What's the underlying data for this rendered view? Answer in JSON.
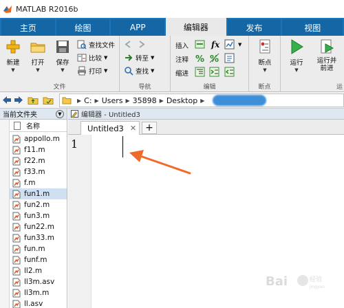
{
  "window": {
    "title": "MATLAB R2016b"
  },
  "ribbon_tabs": [
    {
      "label": "主页"
    },
    {
      "label": "绘图"
    },
    {
      "label": "APP"
    },
    {
      "label": "编辑器"
    },
    {
      "label": "发布"
    },
    {
      "label": "视图"
    }
  ],
  "ribbon": {
    "new_label": "新建",
    "open_label": "打开",
    "save_label": "保存",
    "find_files_label": "查找文件",
    "compare_label": "比较",
    "print_label": "打印",
    "file_group": "文件",
    "goto_label": "转至",
    "find_label": "查找",
    "nav_group": "导航",
    "insert_label": "插入",
    "comment_label": "注释",
    "indent_label": "缩进",
    "fx_label": "fx",
    "edit_group": "编辑",
    "breakpoint_label": "断点",
    "breakpoint_group": "断点",
    "run_label": "运行",
    "run_advance_label": "运行并前进",
    "run_group_partial": "运"
  },
  "address": {
    "segments": [
      "C:",
      "Users",
      "35898",
      "Desktop"
    ]
  },
  "file_panel": {
    "title": "当前文件夹",
    "column_name": "名称",
    "files": [
      {
        "name": "appollo.m",
        "selected": false
      },
      {
        "name": "f11.m",
        "selected": false
      },
      {
        "name": "f22.m",
        "selected": false
      },
      {
        "name": "f33.m",
        "selected": false
      },
      {
        "name": "f.m",
        "selected": false
      },
      {
        "name": "fun1.m",
        "selected": true
      },
      {
        "name": "fun2.m",
        "selected": false
      },
      {
        "name": "fun3.m",
        "selected": false
      },
      {
        "name": "fun22.m",
        "selected": false
      },
      {
        "name": "fun33.m",
        "selected": false
      },
      {
        "name": "fun.m",
        "selected": false
      },
      {
        "name": "funf.m",
        "selected": false
      },
      {
        "name": "ll2.m",
        "selected": false
      },
      {
        "name": "ll3m.asv",
        "selected": false
      },
      {
        "name": "ll3m.m",
        "selected": false
      },
      {
        "name": "ll.asv",
        "selected": false
      }
    ]
  },
  "editor": {
    "title": "编辑器 - Untitled3",
    "doc_tab": "Untitled3",
    "close_glyph": "✕",
    "add_glyph": "+",
    "line_number": "1"
  },
  "colors": {
    "tab_bar": "#1b74b8",
    "ribbon_bg": "#ececec",
    "arrow": "#f06a2a",
    "selected_row": "#cfe0f3"
  }
}
